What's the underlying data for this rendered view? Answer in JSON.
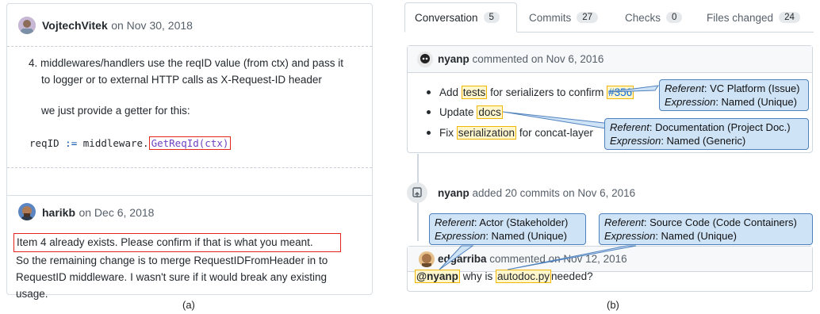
{
  "panel_a": {
    "comment1": {
      "author": "VojtechVitek",
      "date": "on Nov 30, 2018",
      "list_number": "4.",
      "list_text_line1": "middlewares/handlers use the reqID value (from ctx) and pass it",
      "list_text_line2": "to logger or to external HTTP calls as X-Request-ID header",
      "getter_text": "we just provide a getter for this:",
      "code_var": "reqID",
      "code_op": ":=",
      "code_pkg": "middleware.",
      "code_call": "GetReqId(ctx)"
    },
    "comment2": {
      "author": "harikb",
      "date": "on Dec 6, 2018",
      "line1": "Item 4 already exists. Please confirm if that is what you meant.",
      "line2": "So the remaining change is to merge RequestIDFromHeader in to",
      "line3": "RequestID middleware. I wasn't sure if it would break any existing",
      "line4": "usage."
    },
    "caption": "(a)"
  },
  "panel_b": {
    "tabs": [
      {
        "label": "Conversation",
        "count": "5"
      },
      {
        "label": "Commits",
        "count": "27"
      },
      {
        "label": "Checks",
        "count": "0"
      },
      {
        "label": "Files changed",
        "count": "24"
      }
    ],
    "comment1": {
      "author": "nyanp",
      "action": "commented on Nov 6, 2016",
      "bullet1_pre": "Add",
      "bullet1_hl": "tests",
      "bullet1_mid": "for serializers to confirm",
      "bullet1_link": "#356",
      "bullet2_pre": "Update",
      "bullet2_hl": "docs",
      "bullet3_pre": "Fix",
      "bullet3_hl": "serialization",
      "bullet3_post": "for concat-layer"
    },
    "commits_event": {
      "author": "nyanp",
      "action": "added 20 commits on Nov 6, 2016"
    },
    "comment2": {
      "author": "edgarriba",
      "action": "commented on Nov 12, 2016",
      "mention": "@nyanp",
      "text_mid": "why is",
      "file": "autodoc.py",
      "text_end": "needed?"
    },
    "callouts": {
      "c1": {
        "referent_label": "Referent",
        "referent": ": VC Platform (Issue)",
        "expression_label": "Expression",
        "expression": ": Named (Unique)"
      },
      "c2": {
        "referent_label": "Referent",
        "referent": ": Documentation (Project Doc.)",
        "expression_label": "Expression",
        "expression": ": Named (Generic)"
      },
      "c3": {
        "referent_label": "Referent",
        "referent": ": Actor (Stakeholder)",
        "expression_label": "Expression",
        "expression": ": Named (Unique)"
      },
      "c4": {
        "referent_label": "Referent",
        "referent": ": Source Code (Code Containers)",
        "expression_label": "Expression",
        "expression": ": Named (Unique)"
      }
    },
    "caption": "(b)"
  },
  "colors": {
    "highlight_border": "#f2b705",
    "highlight_fill": "#fff6cc",
    "callout_fill": "#cfe3f7",
    "callout_border": "#4f81bd",
    "red_box": "#e1251b",
    "link": "#0969da"
  }
}
